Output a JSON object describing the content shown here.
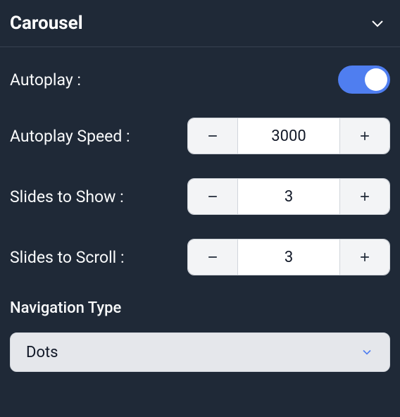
{
  "panel": {
    "title": "Carousel"
  },
  "fields": {
    "autoplay": {
      "label": "Autoplay :",
      "value": true
    },
    "autoplay_speed": {
      "label": "Autoplay Speed :",
      "value": "3000"
    },
    "slides_to_show": {
      "label": "Slides to Show :",
      "value": "3"
    },
    "slides_to_scroll": {
      "label": "Slides to Scroll :",
      "value": "3"
    },
    "navigation_type": {
      "label": "Navigation Type",
      "selected": "Dots"
    }
  }
}
